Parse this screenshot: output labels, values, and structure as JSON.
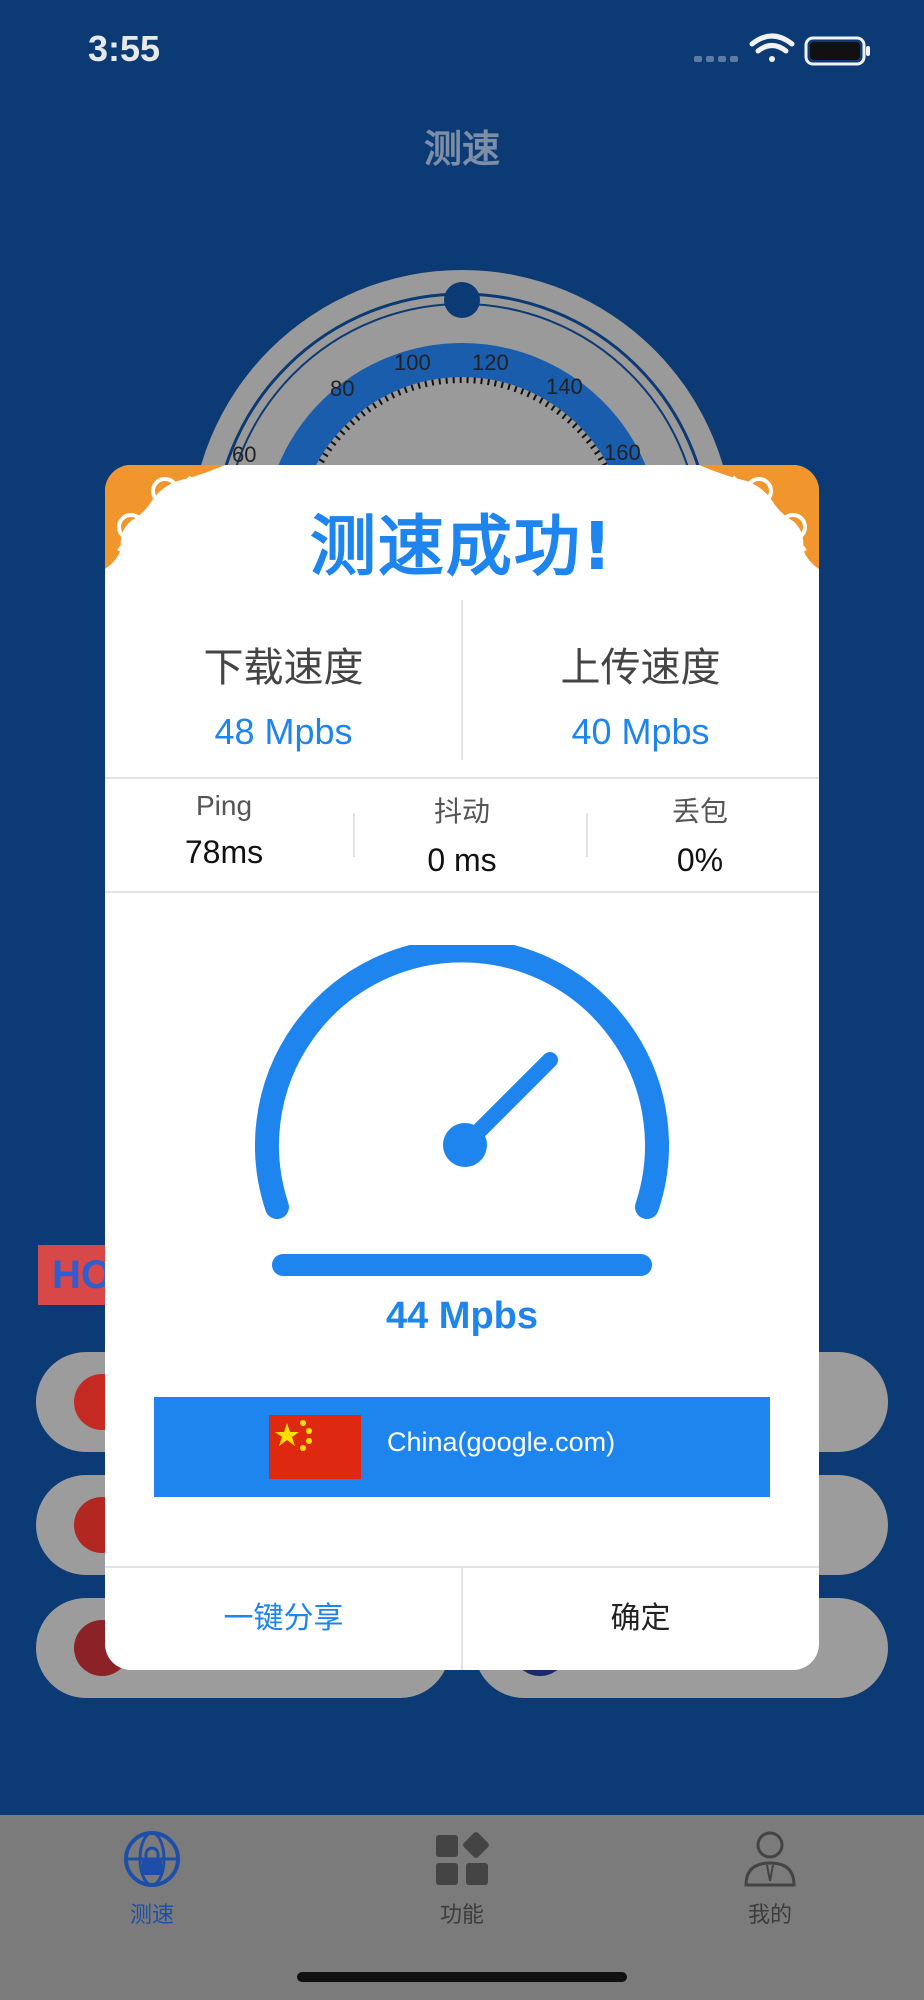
{
  "status_bar": {
    "time": "3:55"
  },
  "page": {
    "title": "测速"
  },
  "background_gauge": {
    "ticks": [
      "60",
      "80",
      "100",
      "120",
      "140",
      "160"
    ]
  },
  "hot_badge": "HO",
  "tab_bar": {
    "items": [
      {
        "label": "测速",
        "icon": "globe-lock-icon",
        "active": true
      },
      {
        "label": "功能",
        "icon": "grid-icon",
        "active": false
      },
      {
        "label": "我的",
        "icon": "person-icon",
        "active": false
      }
    ],
    "active_color": "#1e85ef"
  },
  "modal": {
    "title": "测速成功!",
    "download": {
      "label": "下载速度",
      "value": "48 Mpbs"
    },
    "upload": {
      "label": "上传速度",
      "value": "40 Mpbs"
    },
    "metrics": [
      {
        "label": "Ping",
        "value": "78ms"
      },
      {
        "label": "抖动",
        "value": "0 ms"
      },
      {
        "label": "丢包",
        "value": "0%"
      }
    ],
    "result_speed": "44 Mpbs",
    "server": {
      "name": "China(google.com)",
      "flag": "china-flag-icon"
    },
    "buttons": {
      "share": "一键分享",
      "confirm": "确定"
    },
    "accent_color": "#1e85ef",
    "corner_color": "#f0962d"
  }
}
